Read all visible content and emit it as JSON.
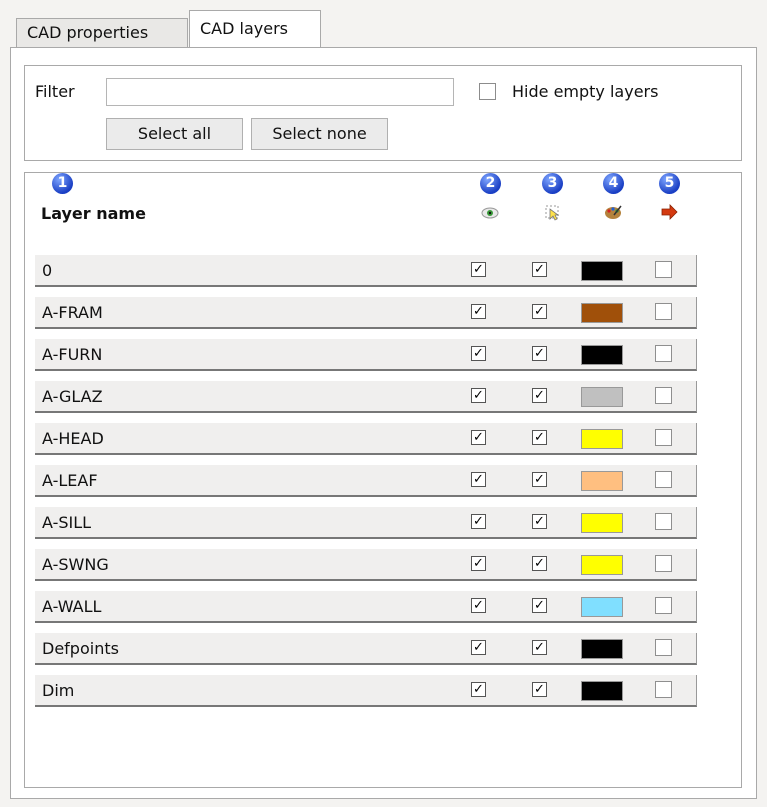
{
  "tabs": {
    "properties": "CAD properties",
    "layers": "CAD layers"
  },
  "filter": {
    "label": "Filter",
    "value": "",
    "placeholder": "",
    "hide_empty_label": "Hide empty layers",
    "hide_empty_checked": false
  },
  "buttons": {
    "select_all": "Select all",
    "select_none": "Select none"
  },
  "header": {
    "layer_name": "Layer name",
    "column_numbers": [
      "1",
      "2",
      "3",
      "4",
      "5"
    ],
    "column_icons": [
      "visibility-icon",
      "selectable-icon",
      "color-palette-icon",
      "export-arrow-icon"
    ]
  },
  "layers": [
    {
      "name": "0",
      "visible": true,
      "selectable": true,
      "color": "#000000",
      "flag5": false
    },
    {
      "name": "A-FRAM",
      "visible": true,
      "selectable": true,
      "color": "#a0500a",
      "flag5": false
    },
    {
      "name": "A-FURN",
      "visible": true,
      "selectable": true,
      "color": "#000000",
      "flag5": false
    },
    {
      "name": "A-GLAZ",
      "visible": true,
      "selectable": true,
      "color": "#c0c0c0",
      "flag5": false
    },
    {
      "name": "A-HEAD",
      "visible": true,
      "selectable": true,
      "color": "#ffff00",
      "flag5": false
    },
    {
      "name": "A-LEAF",
      "visible": true,
      "selectable": true,
      "color": "#ffbf80",
      "flag5": false
    },
    {
      "name": "A-SILL",
      "visible": true,
      "selectable": true,
      "color": "#ffff00",
      "flag5": false
    },
    {
      "name": "A-SWNG",
      "visible": true,
      "selectable": true,
      "color": "#ffff00",
      "flag5": false
    },
    {
      "name": "A-WALL",
      "visible": true,
      "selectable": true,
      "color": "#80dfff",
      "flag5": false
    },
    {
      "name": "Defpoints",
      "visible": true,
      "selectable": true,
      "color": "#000000",
      "flag5": false
    },
    {
      "name": "Dim",
      "visible": true,
      "selectable": true,
      "color": "#000000",
      "flag5": false
    }
  ]
}
